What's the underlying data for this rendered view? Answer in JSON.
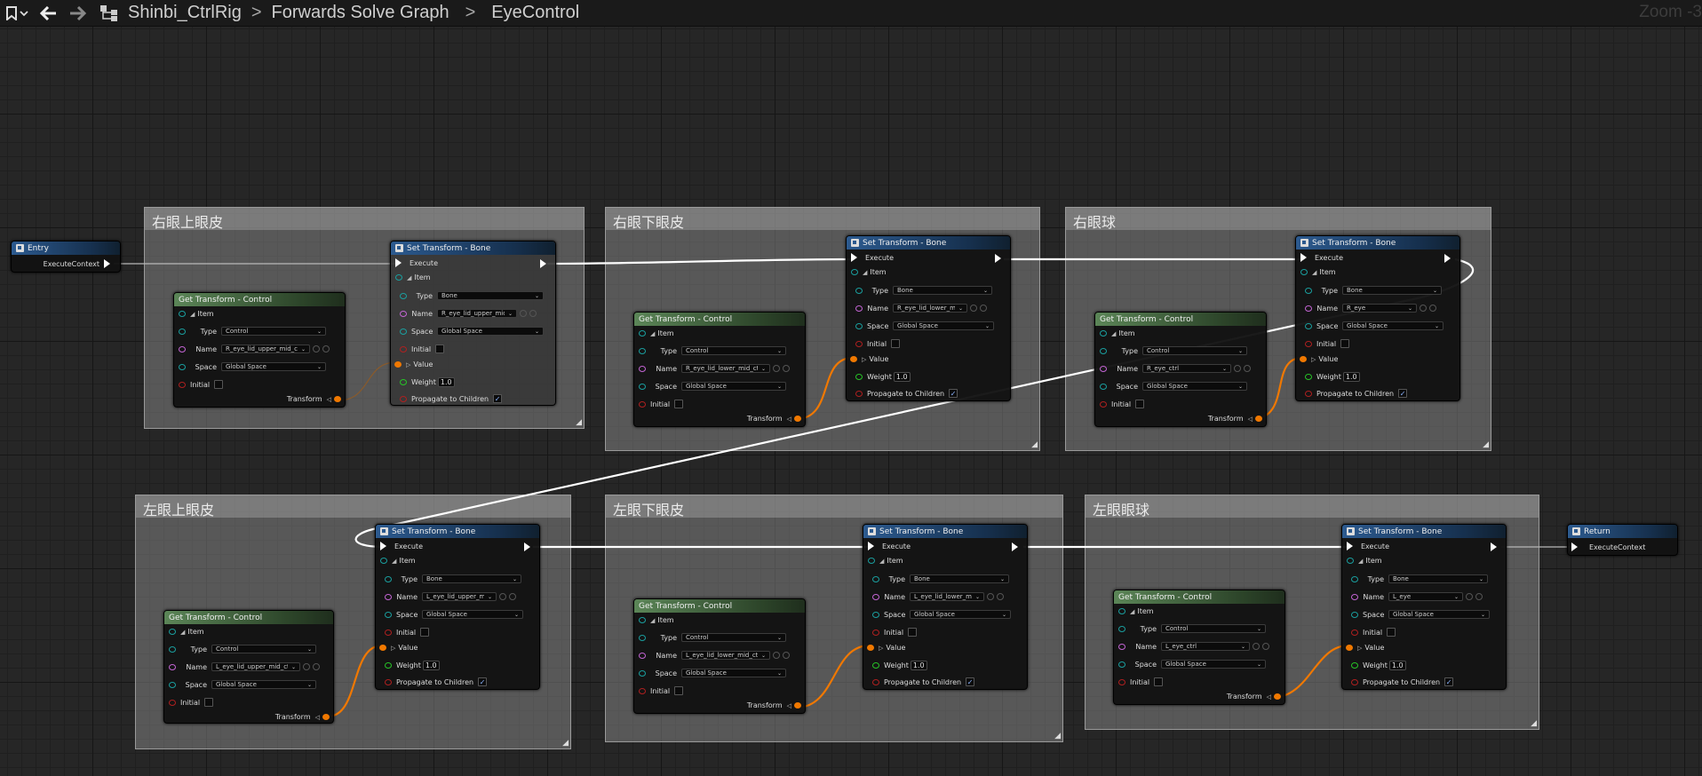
{
  "toolbar": {
    "breadcrumb": [
      "Shinbi_CtrlRig",
      "Forwards Solve Graph",
      "EyeControl"
    ],
    "separator": ">",
    "zoom_label": "Zoom -3"
  },
  "comments": [
    {
      "title": "右眼上眼皮"
    },
    {
      "title": "右眼下眼皮"
    },
    {
      "title": "右眼球"
    },
    {
      "title": "左眼上眼皮"
    },
    {
      "title": "左眼下眼皮"
    },
    {
      "title": "左眼眼球"
    }
  ],
  "entry": {
    "title": "Entry",
    "pin": "ExecuteContext"
  },
  "return": {
    "title": "Return",
    "pin": "ExecuteContext"
  },
  "labels": {
    "set_title": "Set Transform - Bone",
    "get_title": "Get Transform - Control",
    "execute": "Execute",
    "item": "Item",
    "type": "Type",
    "name": "Name",
    "space": "Space",
    "initial": "Initial",
    "value": "Value",
    "weight": "Weight",
    "propagate": "Propagate to Children",
    "transform": "Transform",
    "bone": "Bone",
    "control": "Control",
    "global_space": "Global Space",
    "checkmark": "✓"
  },
  "set_nodes": [
    {
      "bone_name": "R_eye_lid_upper_mid",
      "weight": "1.0",
      "propagate": true
    },
    {
      "bone_name": "R_eye_lid_lower_mid",
      "weight": "1.0",
      "propagate": true
    },
    {
      "bone_name": "R_eye",
      "weight": "1.0",
      "propagate": true
    },
    {
      "bone_name": "L_eye_lid_upper_mid",
      "weight": "1.0",
      "propagate": true
    },
    {
      "bone_name": "L_eye_lid_lower_mid",
      "weight": "1.0",
      "propagate": true
    },
    {
      "bone_name": "L_eye",
      "weight": "1.0",
      "propagate": true
    }
  ],
  "get_nodes": [
    {
      "control_name": "R_eye_lid_upper_mid_ctrl"
    },
    {
      "control_name": "R_eye_lid_lower_mid_ctrl"
    },
    {
      "control_name": "R_eye_ctrl"
    },
    {
      "control_name": "L_eye_lid_upper_mid_ctrl"
    },
    {
      "control_name": "L_eye_lid_lower_mid_ctrl"
    },
    {
      "control_name": "L_eye_ctrl"
    }
  ]
}
